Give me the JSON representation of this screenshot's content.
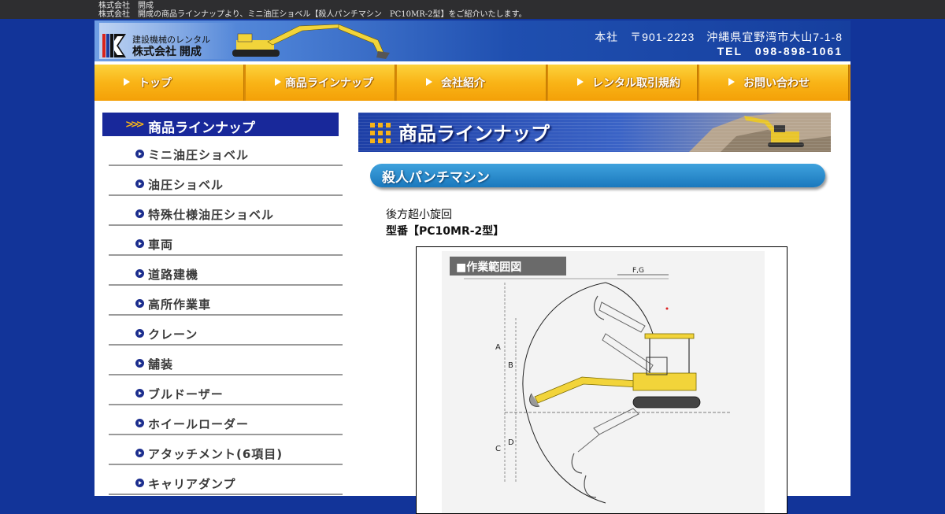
{
  "topbar": {
    "line1": "株式会社　開成",
    "line2": "株式会社　開成の商品ラインナップより、ミニ油圧ショベル【殺人パンチマシン　PC10MR-2型】をご紹介いたします。"
  },
  "header": {
    "logo_small": "建設機械のレンタル",
    "logo_company": "株式会社 開成",
    "address": "本社　〒901-2223　沖縄県宜野湾市大山7-1-8",
    "tel": "TEL　098-898-1061"
  },
  "nav": {
    "items": [
      {
        "label": "トップ"
      },
      {
        "label": "商品ラインナップ"
      },
      {
        "label": "会社紹介"
      },
      {
        "label": "レンタル取引規約"
      },
      {
        "label": "お問い合わせ"
      }
    ]
  },
  "sidebar": {
    "title": "商品ラインナップ",
    "items": [
      {
        "label": "ミニ油圧ショベル"
      },
      {
        "label": "油圧ショベル"
      },
      {
        "label": "特殊仕様油圧ショベル"
      },
      {
        "label": "車両"
      },
      {
        "label": "道路建機"
      },
      {
        "label": "高所作業車"
      },
      {
        "label": "クレーン"
      },
      {
        "label": "舗装"
      },
      {
        "label": "ブルドーザー"
      },
      {
        "label": "ホイールローダー"
      },
      {
        "label": "アタッチメント(6項目)"
      },
      {
        "label": "キャリアダンプ"
      }
    ]
  },
  "main": {
    "banner_title": "商品ラインナップ",
    "product_title": "殺人パンチマシン",
    "description": "後方超小旋回",
    "model": "型番【PC10MR-2型】",
    "figure": {
      "title": "■作業範囲図",
      "labels": [
        "F,G",
        "A",
        "B",
        "C",
        "D"
      ]
    }
  },
  "colors": {
    "page_background": "#123499",
    "nav_orange": "#f9b417",
    "sidebar_header": "#18289a",
    "pill_blue": "#1a78bd",
    "excavator_yellow": "#f2d43a"
  },
  "icons": {
    "nav_arrow": "triangle-right-icon",
    "sidebar_bullet": "circle-arrow-icon",
    "banner_mark": "grid-dots-icon"
  }
}
